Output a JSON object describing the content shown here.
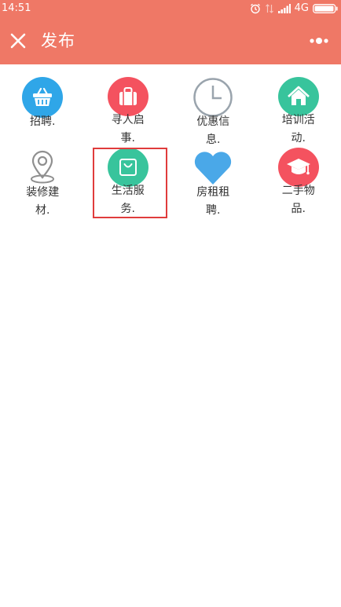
{
  "status_bar": {
    "time": "14:51",
    "network": "4G",
    "icons": [
      "alarm-icon",
      "data-arrows-icon",
      "signal-icon",
      "battery-icon"
    ]
  },
  "header": {
    "title": "发布",
    "close_icon": "close-icon",
    "more_icon": "more-dots-icon",
    "background_color": "#ef7866"
  },
  "categories": [
    {
      "label": "招聘.",
      "icon": "basket-icon",
      "color": "#2fa6e8"
    },
    {
      "label": "寻人启事.",
      "icon": "bag-icon",
      "color": "#f4525f"
    },
    {
      "label": "优惠信息.",
      "icon": "clock-icon",
      "color": "#9aa4ad"
    },
    {
      "label": "培训活动.",
      "icon": "house-icon",
      "color": "#38c49c"
    },
    {
      "label": "装修建材.",
      "icon": "location-pin-icon",
      "color": "#9a9a9a"
    },
    {
      "label": "生活服务.",
      "icon": "shopping-bag-icon",
      "color": "#38c49c"
    },
    {
      "label": "房租租聘.",
      "icon": "heart-icon",
      "color": "#4aa8e8"
    },
    {
      "label": "二手物品.",
      "icon": "graduation-cap-icon",
      "color": "#f4525f"
    }
  ],
  "highlight_color": "#e03c3c"
}
